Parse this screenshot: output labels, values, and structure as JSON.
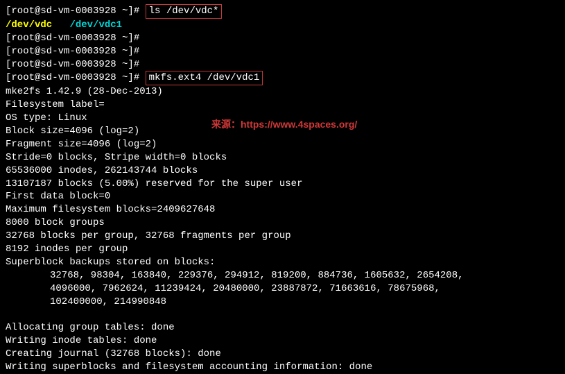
{
  "prompt": "[root@sd-vm-0003928 ~]# ",
  "cmd1": "ls /dev/vdc*",
  "out_ls_part1": "/dev/vdc",
  "out_ls_part2": "/dev/vdc1",
  "cmd2": "mkfs.ext4 /dev/vdc1",
  "mke2fs": {
    "version": "mke2fs 1.42.9 (28-Dec-2013)",
    "label": "Filesystem label=",
    "ostype": "OS type: Linux",
    "blocksize": "Block size=4096 (log=2)",
    "fragsize": "Fragment size=4096 (log=2)",
    "stride": "Stride=0 blocks, Stripe width=0 blocks",
    "inodes": "65536000 inodes, 262143744 blocks",
    "reserved": "13107187 blocks (5.00%) reserved for the super user",
    "firstblock": "First data block=0",
    "maxfs": "Maximum filesystem blocks=2409627648",
    "groups": "8000 block groups",
    "blockspergroup": "32768 blocks per group, 32768 fragments per group",
    "inodespergroup": "8192 inodes per group",
    "sbheader": "Superblock backups stored on blocks:",
    "sbline1": "32768, 98304, 163840, 229376, 294912, 819200, 884736, 1605632, 2654208,",
    "sbline2": "4096000, 7962624, 11239424, 20480000, 23887872, 71663616, 78675968,",
    "sbline3": "102400000, 214990848",
    "alloc": "Allocating group tables: done",
    "writeinode": "Writing inode tables: done",
    "journal": "Creating journal (32768 blocks): done",
    "writesb": "Writing superblocks and filesystem accounting information: done"
  },
  "watermark": {
    "label": "来源：",
    "url": "https://www.4spaces.org/"
  }
}
